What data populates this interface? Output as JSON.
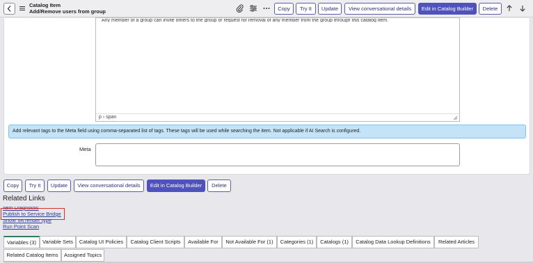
{
  "header": {
    "title_line1": "Catalog Item",
    "title_line2": "Add/Remove users from group",
    "buttons": {
      "copy": "Copy",
      "try_it": "Try It",
      "update": "Update",
      "view_conv": "View conversational details",
      "edit_builder": "Edit in Catalog Builder",
      "delete": "Delete"
    },
    "icons": [
      "chevron-left-icon",
      "hamburger-icon",
      "attachment-icon",
      "settings-sliders-icon",
      "more-icon",
      "arrow-up-icon",
      "arrow-down-icon"
    ]
  },
  "form": {
    "editor_text": "Any member of a group can invite others to the group or request for removal of any member from the group through this catalog item.",
    "editor_path": "p › span",
    "info_message": "Add relevant tags to the Meta field using comma-separated list of tags. These tags will be used while searching the item. Not applicable if AI Search is configured.",
    "meta_label": "Meta",
    "meta_value": ""
  },
  "bottom_buttons": {
    "copy": "Copy",
    "try_it": "Try It",
    "update": "Update",
    "view_conv": "View conversational details",
    "edit_builder": "Edit in Catalog Builder",
    "delete": "Delete"
  },
  "related_links": {
    "title": "Related Links",
    "links": [
      "Item Diagnostic",
      "Publish to Service Bridge",
      "Show VA render type",
      "Run Point Scan"
    ]
  },
  "tabs": {
    "row1": [
      "Variables (3)",
      "Variable Sets",
      "Catalog UI Policies",
      "Catalog Client Scripts",
      "Available For",
      "Not Available For (1)",
      "Categories (1)",
      "Catalogs (1)",
      "Catalog Data Lookup Definitions",
      "Related Articles"
    ],
    "row2": [
      "Related Catalog Items",
      "Assigned Topics"
    ],
    "active": "Variables (3)"
  },
  "colors": {
    "primary": "#4f52bd",
    "info_bg": "#c5e3f6",
    "highlight": "#d93025",
    "active_tab": "#2e7d5b"
  }
}
